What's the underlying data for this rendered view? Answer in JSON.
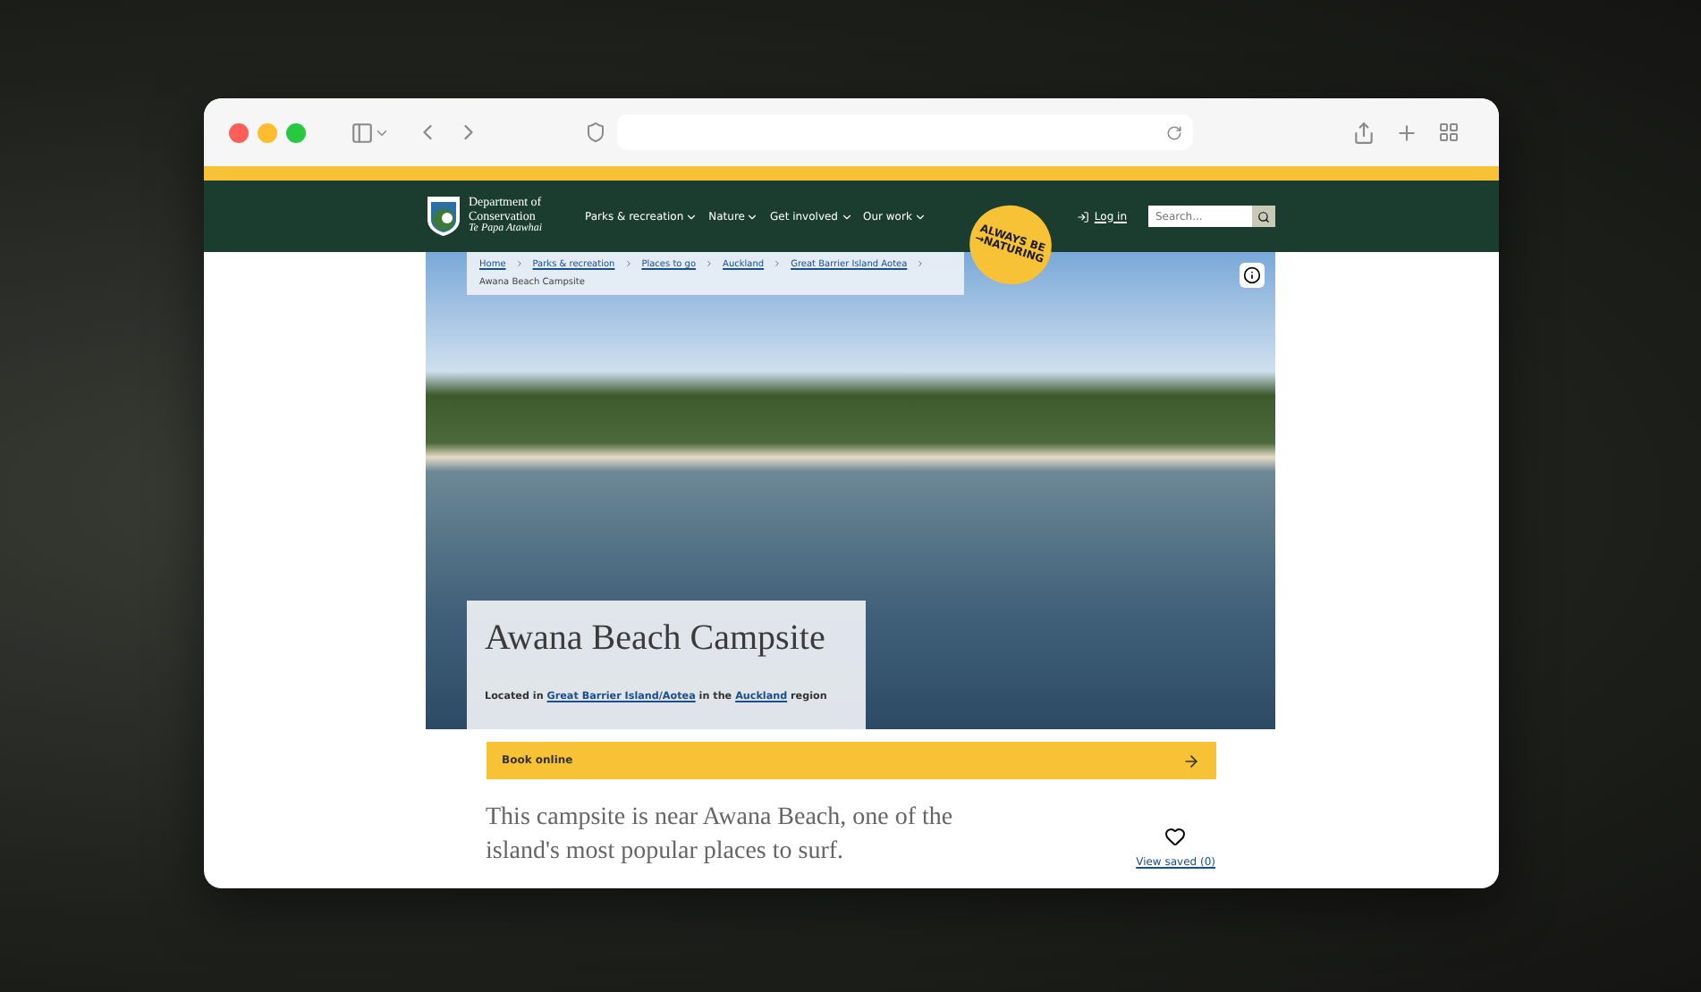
{
  "site_header": {
    "logo": {
      "lines": [
        "Department of",
        "Conservation"
      ],
      "tagline": "Te Papa Atawhai"
    },
    "nav": [
      {
        "label": "Parks & recreation"
      },
      {
        "label": "Nature"
      },
      {
        "label": "Get involved"
      },
      {
        "label": "Our work"
      }
    ],
    "login": "Log in",
    "search": {
      "placeholder": "Search..."
    }
  },
  "sticker": {
    "lines": [
      "ALWAYS BE",
      "→NATURING"
    ]
  },
  "breadcrumb": {
    "items": [
      "Home",
      "Parks & recreation",
      "Places to go",
      "Auckland",
      "Great Barrier Island Aotea"
    ],
    "current": "Awana Beach Campsite"
  },
  "hero": {
    "title": "Awana Beach Campsite",
    "location": [
      {
        "kind": "text",
        "text": "Located in"
      },
      {
        "kind": "link",
        "text": "Great Barrier Island/Aotea"
      },
      {
        "kind": "text",
        "text": "in the"
      },
      {
        "kind": "link",
        "text": "Auckland"
      },
      {
        "kind": "text",
        "text": "region"
      }
    ]
  },
  "book_button": "Book online",
  "intro": "This campsite is near Awana Beach, one of the island's most popular places to surf.",
  "view_saved": "View saved (0)"
}
